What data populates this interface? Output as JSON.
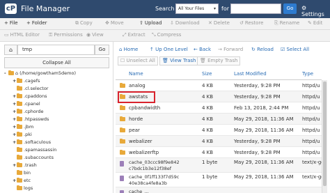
{
  "header": {
    "logo": "cP",
    "title": "File Manager",
    "search_label": "Search",
    "search_scope": "All Your Files",
    "for_label": "for",
    "search_value": "",
    "go_label": "Go",
    "settings_label": "Settings"
  },
  "toolbar1": [
    {
      "icon": "+",
      "label": "File",
      "enabled": true
    },
    {
      "icon": "+",
      "label": "Folder",
      "enabled": true
    },
    {
      "icon": "⧉",
      "label": "Copy",
      "enabled": false
    },
    {
      "icon": "✥",
      "label": "Move",
      "enabled": false
    },
    {
      "icon": "⇧",
      "label": "Upload",
      "enabled": true
    },
    {
      "icon": "⇩",
      "label": "Download",
      "enabled": false
    },
    {
      "icon": "✕",
      "label": "Delete",
      "enabled": false
    },
    {
      "icon": "↺",
      "label": "Restore",
      "enabled": false
    },
    {
      "icon": "⎘",
      "label": "Rename",
      "enabled": false
    },
    {
      "icon": "✎",
      "label": "Edit",
      "enabled": false
    }
  ],
  "toolbar2": [
    {
      "icon": "▭",
      "label": "HTML Editor",
      "enabled": false
    },
    {
      "icon": "⚿",
      "label": "Permissions",
      "enabled": false
    },
    {
      "icon": "◉",
      "label": "View",
      "enabled": false
    },
    {
      "icon": "⤢",
      "label": "Extract",
      "enabled": false
    },
    {
      "icon": "⤡",
      "label": "Compress",
      "enabled": false
    }
  ],
  "left": {
    "path_value": "tmp",
    "go_label": "Go",
    "collapse_label": "Collapse All",
    "tree": [
      {
        "label": "(/home/gowtham5demo)",
        "level": 0,
        "pm": "-",
        "home": true
      },
      {
        "label": ".cagefs",
        "level": 1,
        "pm": "+"
      },
      {
        "label": ".cl.selector",
        "level": 1,
        "pm": ""
      },
      {
        "label": ".cpaddons",
        "level": 1,
        "pm": "+"
      },
      {
        "label": ".cpanel",
        "level": 1,
        "pm": "+"
      },
      {
        "label": ".cphorde",
        "level": 1,
        "pm": "+"
      },
      {
        "label": ".htpasswds",
        "level": 1,
        "pm": "+"
      },
      {
        "label": ".jbm",
        "level": 1,
        "pm": "+"
      },
      {
        "label": ".pki",
        "level": 1,
        "pm": "+"
      },
      {
        "label": ".softaculous",
        "level": 1,
        "pm": "+"
      },
      {
        "label": ".spamassassin",
        "level": 1,
        "pm": ""
      },
      {
        "label": ".subaccounts",
        "level": 1,
        "pm": ""
      },
      {
        "label": ".trash",
        "level": 1,
        "pm": "+"
      },
      {
        "label": "bin",
        "level": 1,
        "pm": ""
      },
      {
        "label": "etc",
        "level": 1,
        "pm": "+"
      },
      {
        "label": "logs",
        "level": 1,
        "pm": ""
      }
    ]
  },
  "nav": {
    "home": "Home",
    "up": "Up One Level",
    "back": "Back",
    "forward": "Forward",
    "reload": "Reload",
    "select_all": "Select All",
    "unselect_all": "Unselect All",
    "view_trash": "View Trash",
    "empty_trash": "Empty Trash"
  },
  "table": {
    "columns": [
      "Name",
      "Size",
      "Last Modified",
      "Type"
    ],
    "rows": [
      {
        "name": "analog",
        "size": "4 KB",
        "modified": "Yesterday, 9:28 PM",
        "type": "httpd/u",
        "kind": "folder"
      },
      {
        "name": "awstats",
        "size": "4 KB",
        "modified": "Yesterday, 9:28 PM",
        "type": "httpd/u",
        "kind": "folder",
        "highlighted": true
      },
      {
        "name": "cpbandwidth",
        "size": "4 KB",
        "modified": "Feb 13, 2018, 2:44 PM",
        "type": "httpd/u",
        "kind": "folder"
      },
      {
        "name": "horde",
        "size": "4 KB",
        "modified": "May 29, 2018, 11:36 AM",
        "type": "httpd/u",
        "kind": "folder"
      },
      {
        "name": "pear",
        "size": "4 KB",
        "modified": "May 29, 2018, 11:36 AM",
        "type": "httpd/u",
        "kind": "folder"
      },
      {
        "name": "webalizer",
        "size": "4 KB",
        "modified": "Yesterday, 9:28 PM",
        "type": "httpd/u",
        "kind": "folder"
      },
      {
        "name": "webalizerftp",
        "size": "4 KB",
        "modified": "Yesterday, 9:28 PM",
        "type": "httpd/u",
        "kind": "folder"
      },
      {
        "name": "cache_03ccc98f9e842c7bdc1b3e12f38ef",
        "name_line1": "cache_03ccc98f9e842",
        "name_line2": "c7bdc1b3e12f38ef",
        "size": "1 byte",
        "modified": "May 29, 2018, 11:36 AM",
        "type": "text/x-ge",
        "kind": "file"
      },
      {
        "name": "cache_0f1ff133f7d59c40e38ca4fe8a3b",
        "name_line1": "cache_0f1ff133f7d59c",
        "name_line2": "40e38ca4fe8a3b",
        "size": "1 byte",
        "modified": "May 29, 2018, 11:36 AM",
        "type": "text/x-ge",
        "kind": "file"
      },
      {
        "name": "cache_...",
        "name_line1": "cache_...",
        "name_line2": "",
        "size": "",
        "modified": "",
        "type": "",
        "kind": "file"
      }
    ]
  }
}
